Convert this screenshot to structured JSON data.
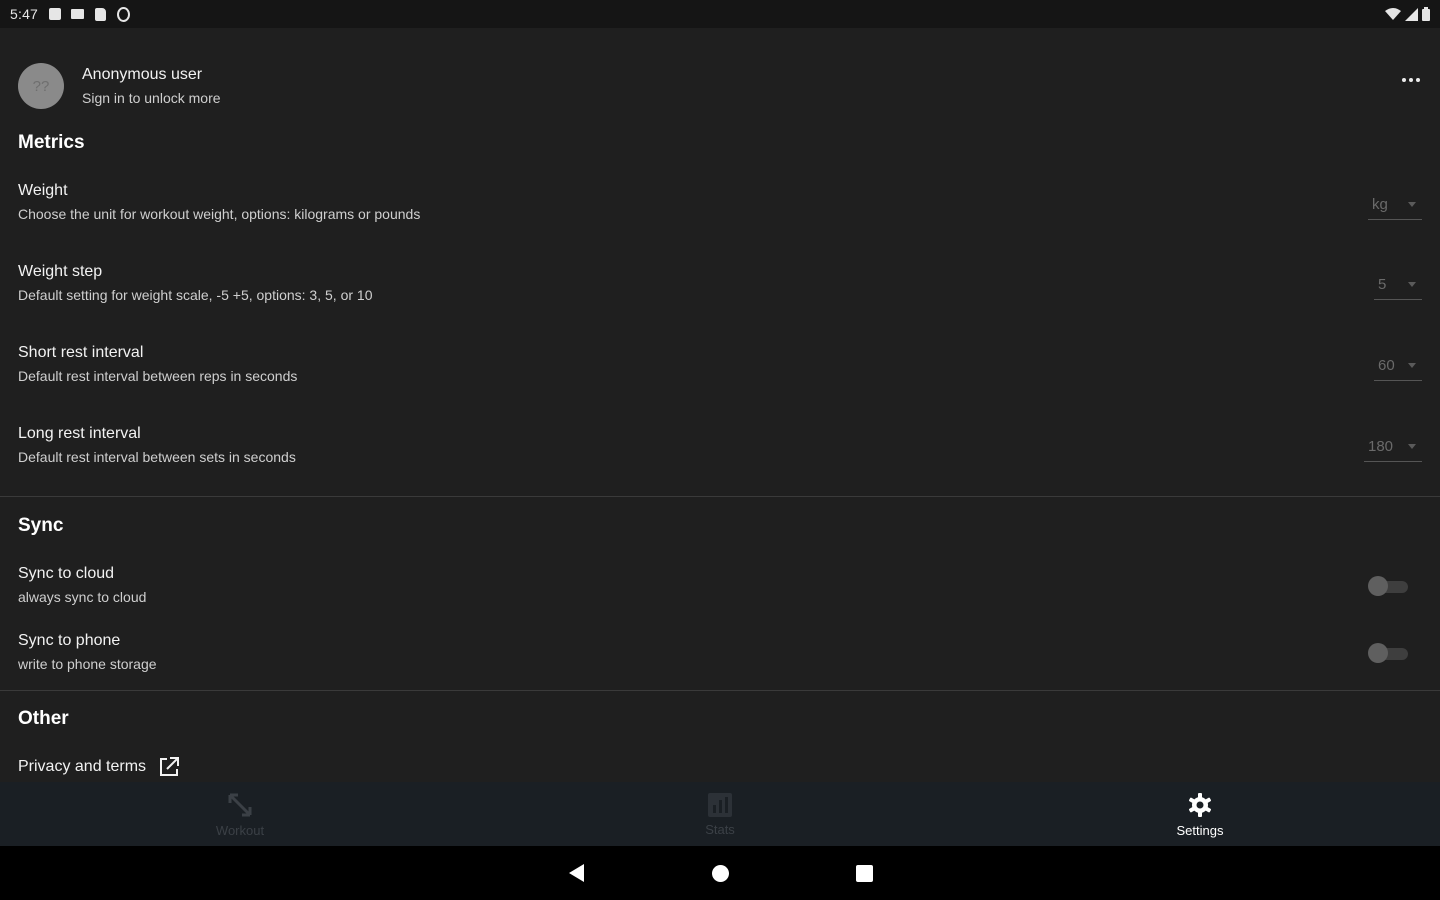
{
  "status_bar": {
    "time": "5:47",
    "left_icons": [
      "notification-icon",
      "mail-icon",
      "sd-card-icon",
      "sync-circle-icon"
    ],
    "right_icons": [
      "wifi-icon",
      "signal-icon",
      "battery-icon"
    ]
  },
  "user": {
    "avatar_text": "??",
    "name": "Anonymous user",
    "subtitle": "Sign in to unlock more"
  },
  "sections": {
    "metrics": {
      "title": "Metrics",
      "weight": {
        "title": "Weight",
        "desc": "Choose the unit for workout weight, options: kilograms or pounds",
        "value": "kg"
      },
      "weight_step": {
        "title": "Weight step",
        "desc": "Default setting for weight scale, -5 +5, options: 3, 5, or 10",
        "value": "5"
      },
      "short_rest": {
        "title": "Short rest interval",
        "desc": "Default rest interval between reps in seconds",
        "value": "60"
      },
      "long_rest": {
        "title": "Long rest interval",
        "desc": "Default rest interval between sets in seconds",
        "value": "180"
      }
    },
    "sync": {
      "title": "Sync",
      "cloud": {
        "title": "Sync to cloud",
        "desc": "always sync to cloud",
        "enabled": false
      },
      "phone": {
        "title": "Sync to phone",
        "desc": "write to phone storage",
        "enabled": false
      }
    },
    "other": {
      "title": "Other",
      "privacy": {
        "label": "Privacy and terms"
      }
    }
  },
  "bottom_nav": {
    "items": [
      {
        "label": "Workout",
        "icon": "expand-arrows-icon",
        "active": false
      },
      {
        "label": "Stats",
        "icon": "chart-icon",
        "active": false
      },
      {
        "label": "Settings",
        "icon": "gear-icon",
        "active": true
      }
    ]
  },
  "colors": {
    "background": "#1f1f1f",
    "status_bar": "#151515",
    "nav_bar": "#1a1f24",
    "system_nav": "#000000",
    "text_primary": "#f2f2f2",
    "text_secondary": "#cfcfcf"
  }
}
